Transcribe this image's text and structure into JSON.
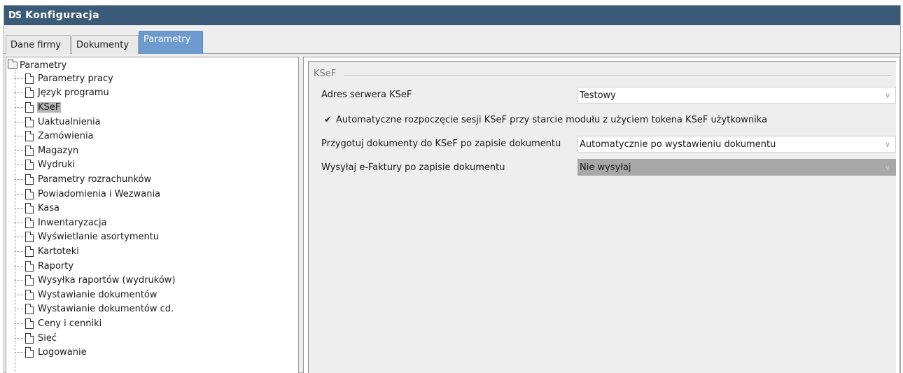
{
  "window": {
    "logo": "DS",
    "title": "Konfiguracja"
  },
  "tabs": [
    {
      "label": "Dane firmy",
      "active": false
    },
    {
      "label": "Dokumenty",
      "active": false
    },
    {
      "label": "Parametry",
      "active": true
    }
  ],
  "tree": {
    "root": "Parametry",
    "items": [
      "Parametry pracy",
      "Język programu",
      "KSeF",
      "Uaktualnienia",
      "Zamówienia",
      "Magazyn",
      "Wydruki",
      "Parametry rozrachunków",
      "Powiadomienia i Wezwania",
      "Kasa",
      "Inwentaryzacja",
      "Wyświetlanie asortymentu",
      "Kartoteki",
      "Raporty",
      "Wysyłka raportów (wydruków)",
      "Wystawianie dokumentów",
      "Wystawianie dokumentów cd.",
      "Ceny i cenniki",
      "Sieć",
      "Logowanie"
    ],
    "selected": "KSeF"
  },
  "ksef": {
    "group_title": "KSeF",
    "server_label": "Adres serwera KSeF",
    "server_value": "Testowy",
    "auto_session_label": "Automatyczne rozpoczęcie sesji KSeF przy starcie modułu z użyciem tokena KSeF użytkownika",
    "auto_session_checked": true,
    "prepare_label": "Przygotuj dokumenty do KSeF po zapisie dokumentu",
    "prepare_value": "Automatycznie po wystawieniu dokumentu",
    "send_label": "Wysyłaj e-Faktury po zapisie dokumentu",
    "send_value": "Nie wysyłaj"
  },
  "icons": {
    "check": "checkmark-icon",
    "dropdown": "chevron-down-icon",
    "folder": "folder-icon",
    "document": "document-icon"
  },
  "colors": {
    "titlebar": "#3b5a78",
    "active_tab": "#6f9ad0",
    "selection": "#b5b5b5",
    "disabled_combo": "#a8a8a8"
  }
}
